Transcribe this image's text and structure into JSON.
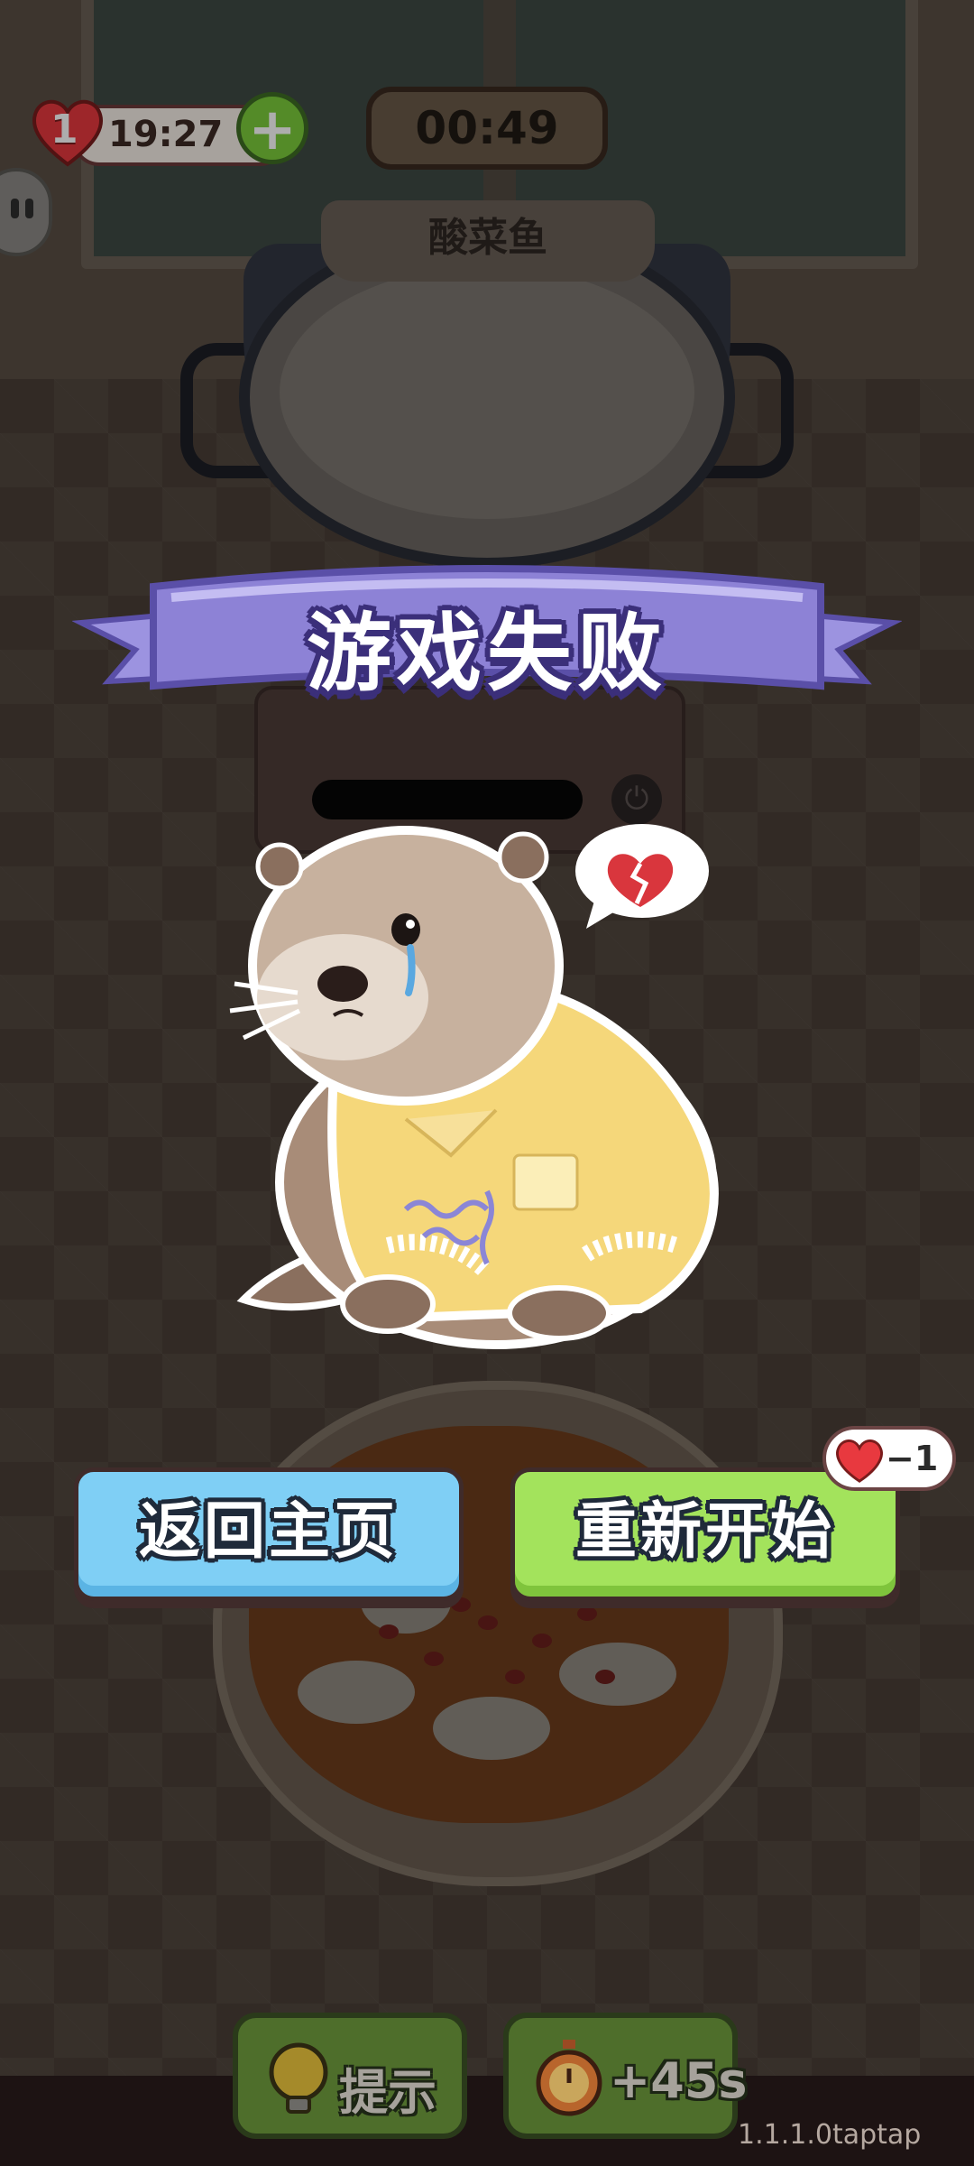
{
  "hud": {
    "lives_count": "1",
    "lives_timer": "19:27",
    "add_lives_label": "+",
    "level_timer": "00:49"
  },
  "dish": {
    "name": "酸菜鱼"
  },
  "result": {
    "title": "游戏失败"
  },
  "buttons": {
    "home_label": "返回主页",
    "restart_label": "重新开始",
    "restart_cost": "−1"
  },
  "powerups": {
    "hint_label": "提示",
    "time_label": "+45s"
  },
  "footer": {
    "version": "1.1.1.0taptap"
  },
  "colors": {
    "heart_red": "#e8393f",
    "banner_purple": "#8d82d6",
    "home_button_blue": "#7fcff5",
    "restart_button_green": "#a3e35c",
    "otter_shirt_yellow": "#f5d77a"
  },
  "icons": [
    "heart-icon",
    "plus-icon",
    "side-menu-icon",
    "broken-heart-icon",
    "power-icon",
    "lightbulb-icon",
    "stopwatch-icon"
  ]
}
